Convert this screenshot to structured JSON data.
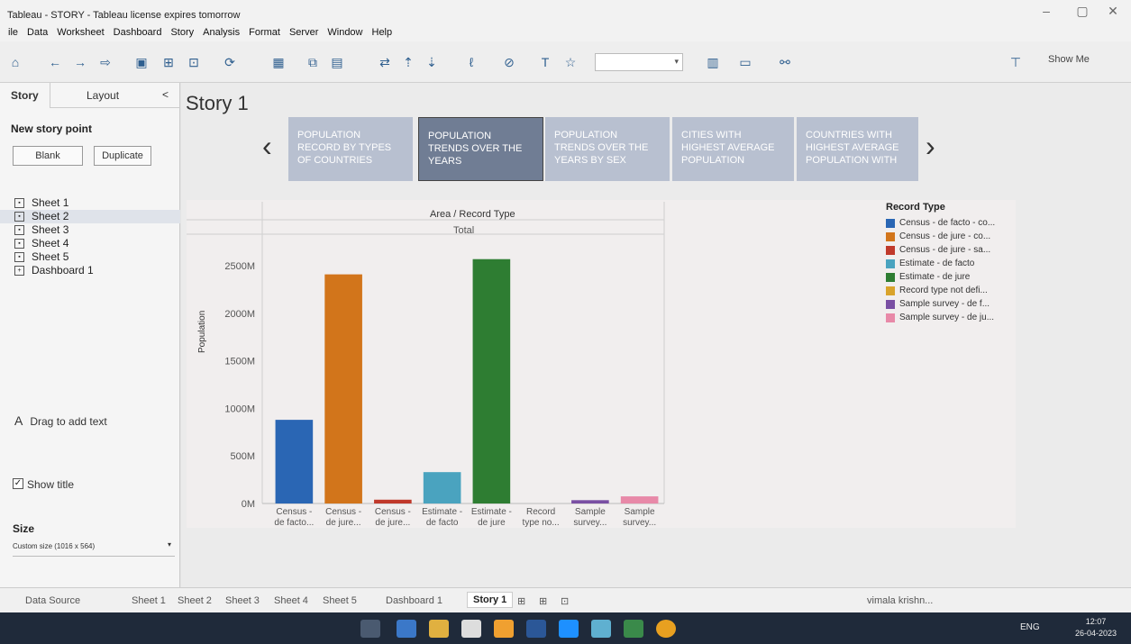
{
  "window": {
    "title": "Tableau - STORY - Tableau license expires tomorrow",
    "minimize_label": "–",
    "maximize_label": "▢",
    "close_label": "✕"
  },
  "menu": [
    "ile",
    "Data",
    "Worksheet",
    "Dashboard",
    "Story",
    "Analysis",
    "Format",
    "Server",
    "Window",
    "Help"
  ],
  "toolbar": {
    "show_me_label": "Show Me",
    "combo_value": ""
  },
  "left_panel": {
    "tabs": {
      "story": "Story",
      "layout": "Layout"
    },
    "collapse_glyph": "<",
    "new_story_point": "New story point",
    "blank_button": "Blank",
    "duplicate_button": "Duplicate",
    "sheets": [
      "Sheet 1",
      "Sheet 2",
      "Sheet 3",
      "Sheet 4",
      "Sheet 5",
      "Dashboard 1"
    ],
    "drag_text": "Drag to add text",
    "drag_glyph": "A",
    "show_title": "Show title",
    "size_label": "Size",
    "size_value": "Custom size (1016 x 564)"
  },
  "story": {
    "title": "Story 1",
    "points": [
      "POPULATION RECORD BY TYPES OF COUNTRIES",
      "POPULATION TRENDS OVER THE YEARS",
      "POPULATION TRENDS OVER THE YEARS BY SEX",
      "CITIES WITH HIGHEST AVERAGE POPULATION",
      "COUNTRIES WITH HIGHEST AVERAGE POPULATION WITH"
    ],
    "active_point": 1
  },
  "chart_data": {
    "type": "bar",
    "title": "Area / Record Type",
    "subtitle": "Total",
    "ylabel": "Population",
    "ylim": [
      0,
      2700
    ],
    "y_ticks": [
      "0M",
      "500M",
      "1000M",
      "1500M",
      "2000M",
      "2500M"
    ],
    "y_tick_values": [
      0,
      500,
      1000,
      1500,
      2000,
      2500
    ],
    "categories": [
      [
        "Census -",
        "de facto..."
      ],
      [
        "Census -",
        "de jure..."
      ],
      [
        "Census -",
        "de jure..."
      ],
      [
        "Estimate -",
        "de facto"
      ],
      [
        "Estimate -",
        "de jure"
      ],
      [
        "Record",
        "type no..."
      ],
      [
        "Sample",
        "survey..."
      ],
      [
        "Sample",
        "survey..."
      ]
    ],
    "values": [
      880,
      2410,
      40,
      330,
      2570,
      0,
      35,
      75
    ],
    "colors": [
      "#2a66b4",
      "#d2751b",
      "#c0392b",
      "#4aa3bf",
      "#2e7d32",
      "#d9a32b",
      "#7a4fa3",
      "#e889a8"
    ],
    "legend_title": "Record Type",
    "legend": [
      "Census - de facto - co...",
      "Census - de jure - co...",
      "Census - de jure - sa...",
      "Estimate - de facto",
      "Estimate - de jure",
      "Record type not defi...",
      "Sample survey - de f...",
      "Sample survey - de ju..."
    ],
    "legend_placement": "right"
  },
  "bottom_tabs": {
    "data_source": "Data Source",
    "sheets": [
      "Sheet 1",
      "Sheet 2",
      "Sheet 3",
      "Sheet 4",
      "Sheet 5",
      "Dashboard 1",
      "Story 1"
    ],
    "active": "Story 1",
    "user": "vimala krishn..."
  },
  "taskbar": {
    "language": "ENG",
    "time": "12:07",
    "date": "26-04-2023"
  }
}
